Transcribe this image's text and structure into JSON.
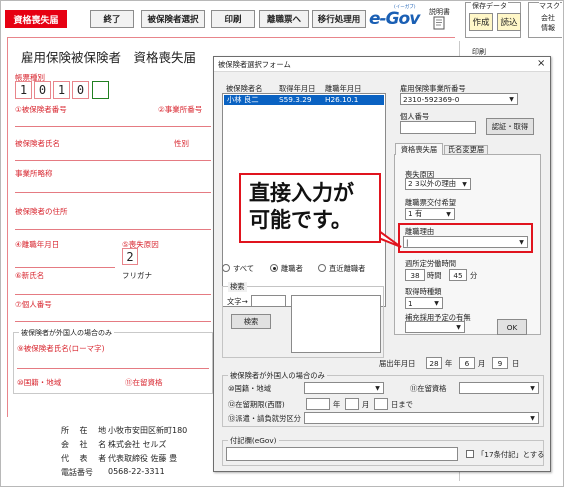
{
  "toolbar": {
    "title": "資格喪失届",
    "buttons": [
      "終了",
      "被保険者選択",
      "印刷",
      "離職票へ",
      "移行処理用"
    ],
    "egov_logo": "e-Gov",
    "egov_small": "(イーガブ)",
    "manual": "説明書",
    "save_data_label": "保存データ",
    "create": "作成",
    "load": "読込",
    "mask_label": "マスク",
    "company_label": "会社",
    "info_label": "情報"
  },
  "form": {
    "title": "雇用保険被保険者　資格喪失届",
    "form_type_label": "帳票種別",
    "form_type_digits": [
      "1",
      "0",
      "1",
      "0"
    ],
    "labels": {
      "insured_no": "①被保険者番号",
      "office_no": "②事業所番号",
      "insured_name": "被保険者氏名",
      "gender": "性別",
      "office_abbr": "事業所略称",
      "insured_address": "被保険者の住所",
      "separation_date": "④離職年月日",
      "loss_reason": "⑤喪失原因",
      "new_name": "⑥新氏名",
      "furigana": "フリガナ",
      "personal_no": "⑦個人番号",
      "foreign_section": "被保険者が外国人の場合のみ",
      "foreign_name": "⑨被保険者氏名(ローマ字)",
      "nationality": "⑩国籍・地域",
      "residence_status": "⑪在留資格"
    },
    "loss_reason_value": "2",
    "print_label": "印刷",
    "company": {
      "address_label": "所 在 地",
      "address_value": "小牧市安田区新町180",
      "name_label": "会 社 名",
      "name_value": "株式会社 セルズ",
      "rep_label": "代 表 者",
      "rep_value": "代表取締役 佐藤 豊",
      "phone_label": "電話番号",
      "phone_value": "0568-22-3311"
    }
  },
  "dialog": {
    "title": "被保険者選択フォーム",
    "close": "×",
    "list_headers": [
      "被保険者名",
      "取得年月日",
      "離職年月日"
    ],
    "list_rows": [
      {
        "name": "小林 良二",
        "acquired": "S59.3.29",
        "separated": "H26.10.1"
      }
    ],
    "office_no_label": "雇用保険事業所番号",
    "office_no_value": "2310-592369-0",
    "personal_no_label": "個人番号",
    "auth_button": "認証・取得",
    "tabs": [
      "資格喪失届",
      "氏名変更届"
    ],
    "loss_reason_label": "喪失原因",
    "loss_reason_value": "2 3以外の理由",
    "ticket_request_label": "離職票交付希望",
    "ticket_request_value": "1 有",
    "separation_reason_label": "離職理由",
    "separation_reason_value": "|",
    "weekly_hours_label": "週所定労働時間",
    "weekly_hours_h": "38",
    "hours_unit": "時間",
    "weekly_hours_m": "45",
    "minutes_unit": "分",
    "qualification_label": "取得時種類",
    "qualification_value": "1",
    "supplement_label": "補充採用予定の有無",
    "ok": "OK",
    "filter_options": [
      "すべて",
      "離職者",
      "直近離職者"
    ],
    "filter_selected": 1,
    "search_group": "検索",
    "text_label": "文字→",
    "search_button": "検索",
    "report_date_label": "届出年月日",
    "report_date": {
      "year": "28",
      "year_unit": "年",
      "month": "6",
      "month_unit": "月",
      "day": "9",
      "day_unit": "日"
    },
    "foreign_group": "被保険者が外国人の場合のみ",
    "nationality_label": "⑩国籍・地域",
    "residence_label": "⑪在留資格",
    "period_label": "⑫在留期限(西暦)",
    "period_year": "年",
    "period_month": "月",
    "period_day": "日まで",
    "dispatch_label": "⑬派遣・請負就労区分",
    "note_label": "付記欄(eGov)",
    "note_check": "「17条付記」とする"
  },
  "callout": {
    "line1": "直接入力が",
    "line2": "可能です。",
    "border_color": "#e0141e"
  }
}
